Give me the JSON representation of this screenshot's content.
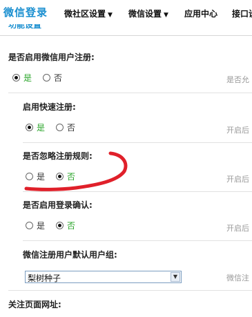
{
  "nav": {
    "brand": "微信登录",
    "items": [
      {
        "label": "微社区设置",
        "has_caret": true
      },
      {
        "label": "微信设置",
        "has_caret": true
      },
      {
        "label": "应用中心",
        "has_caret": false
      },
      {
        "label": "接口设",
        "has_caret": false
      }
    ]
  },
  "section_tab": "功能设置",
  "rows": [
    {
      "label": "是否启用微信用户注册:",
      "options": [
        "是",
        "否"
      ],
      "selected": 0,
      "hint": "是否允"
    },
    {
      "label": "启用快速注册:",
      "options": [
        "是",
        "否"
      ],
      "selected": 0,
      "hint": "开启后"
    },
    {
      "label": "是否忽略注册规则:",
      "options": [
        "是",
        "否"
      ],
      "selected": 1,
      "hint": "开启后"
    },
    {
      "label": "是否启用登录确认:",
      "options": [
        "是",
        "否"
      ],
      "selected": 1,
      "hint": "开启后"
    }
  ],
  "group_select": {
    "label": "微信注册用户默认用户组:",
    "value": "梨树种子",
    "hint": "微信注"
  },
  "follow_url_label": "关注页面网址:",
  "colors": {
    "brand": "#1a8fd0",
    "selected_text": "#2aa52a",
    "annotation": "#e0202a"
  },
  "icons": {
    "caret": "▼",
    "select_arrow": "▼"
  }
}
